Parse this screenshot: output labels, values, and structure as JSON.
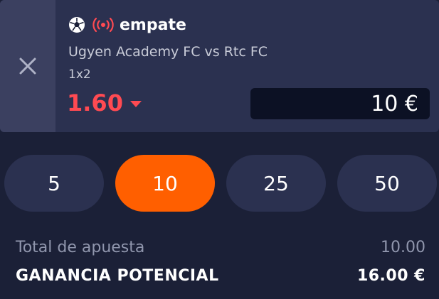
{
  "selection": {
    "name": "empate",
    "match": "Ugyen Academy FC vs Rtc FC",
    "market": "1x2",
    "odds": "1.60",
    "stake_value": "10 €",
    "icons": [
      "soccer-ball-icon",
      "live-broadcast-icon",
      "close-icon"
    ],
    "colors": {
      "odds": "#ff4a52",
      "live": "#ff4a52"
    }
  },
  "quick_stakes": {
    "options": [
      "5",
      "10",
      "25",
      "50"
    ],
    "selected": "10",
    "colors": {
      "active": "#ff5f00",
      "inactive": "#2b3150"
    }
  },
  "summary": {
    "total_label": "Total de apuesta",
    "total_value": "10.00",
    "gain_label": "GANANCIA POTENCIAL",
    "gain_value": "16.00 €"
  }
}
